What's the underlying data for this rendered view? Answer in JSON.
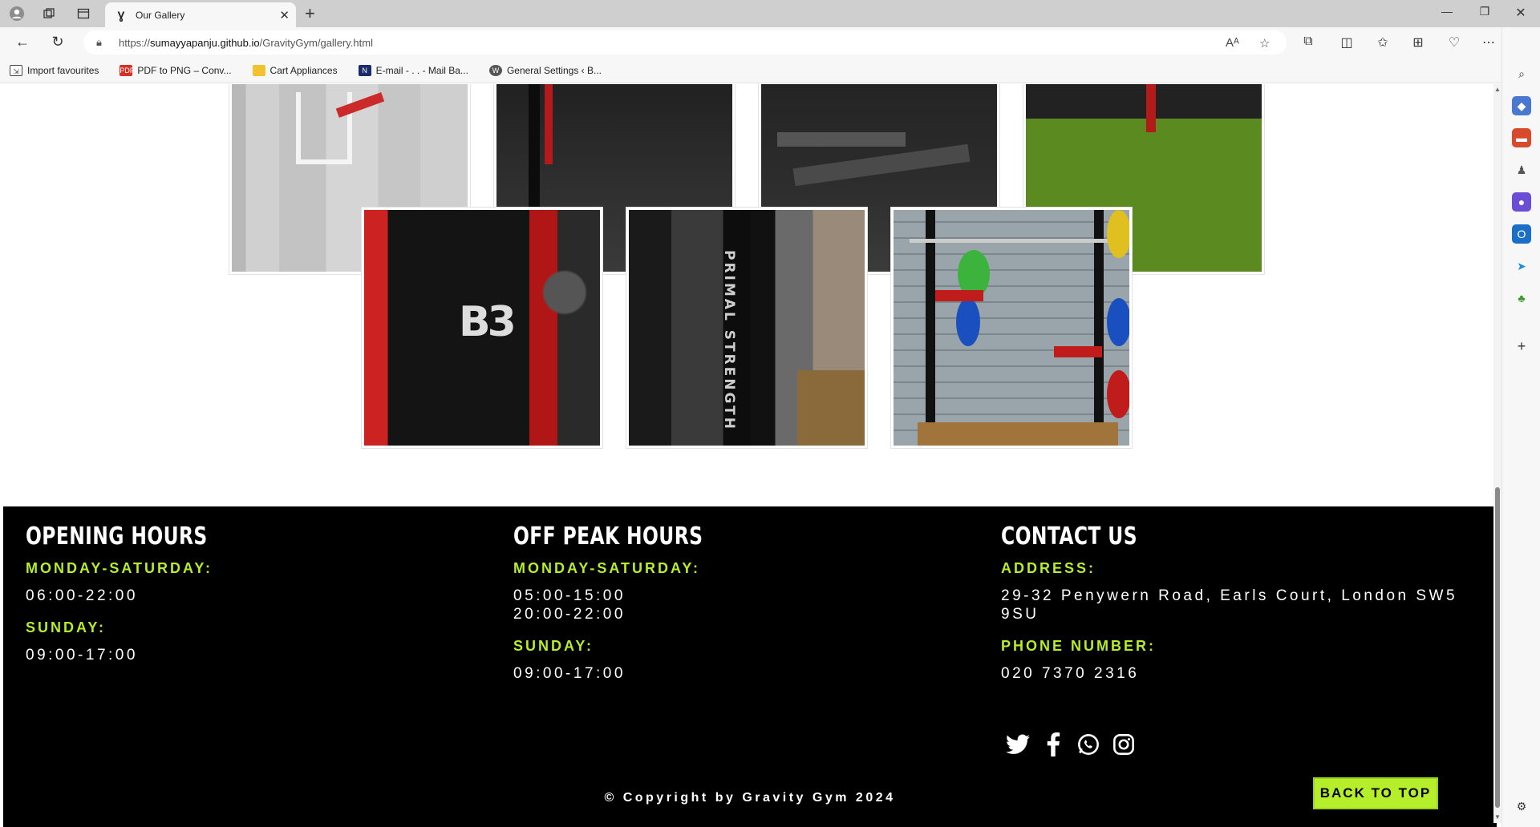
{
  "browser": {
    "tab_title": "Our Gallery",
    "url_scheme": "https://",
    "url_host": "sumayyapanju.github.io",
    "url_path": "/GravityGym/gallery.html",
    "bookmarks": [
      {
        "label": "Import favourites",
        "icon": "import-icon",
        "color": "#444444"
      },
      {
        "label": "PDF to PNG – Conv...",
        "icon": "pdf-icon",
        "color": "#d93025"
      },
      {
        "label": "Cart Appliances",
        "icon": "folder-icon",
        "color": "#f2c230"
      },
      {
        "label": "E-mail - . . - Mail Ba...",
        "icon": "mail-icon",
        "color": "#1b2a6b"
      },
      {
        "label": "General Settings ‹ B...",
        "icon": "wordpress-icon",
        "color": "#555555"
      }
    ]
  },
  "gallery": {
    "images": [
      {
        "alt": "gym-floor-machine"
      },
      {
        "alt": "power-rack-black"
      },
      {
        "alt": "adjustable-benches"
      },
      {
        "alt": "turf-training-area"
      },
      {
        "alt": "b3-jacket"
      },
      {
        "alt": "primal-strength-rack"
      },
      {
        "alt": "plate-loaded-squat-rack"
      }
    ],
    "overlay_b3": "B3",
    "overlay_primal": "PRIMAL STRENGTH"
  },
  "footer": {
    "opening": {
      "title": "OPENING HOURS",
      "weekday_label": "MONDAY-SATURDAY:",
      "weekday_hours": "06:00-22:00",
      "sunday_label": "SUNDAY:",
      "sunday_hours": "09:00-17:00"
    },
    "offpeak": {
      "title": "OFF PEAK HOURS",
      "weekday_label": "MONDAY-SATURDAY:",
      "weekday_hours_1": "05:00-15:00",
      "weekday_hours_2": "20:00-22:00",
      "sunday_label": "SUNDAY:",
      "sunday_hours": "09:00-17:00"
    },
    "contact": {
      "title": "CONTACT US",
      "address_label": "ADDRESS:",
      "address_line_1": "29-32 Penywern Road, Earls Court, London SW5",
      "address_line_2": "9SU",
      "phone_label": "PHONE NUMBER:",
      "phone": "020 7370 2316"
    },
    "social": [
      "twitter-icon",
      "facebook-icon",
      "whatsapp-icon",
      "instagram-icon"
    ],
    "copyright": "© Copyright by Gravity Gym 2024",
    "back_to_top": "BACK TO TOP"
  },
  "colors": {
    "accent": "#b5ee2a",
    "footer_bg": "#000000"
  }
}
